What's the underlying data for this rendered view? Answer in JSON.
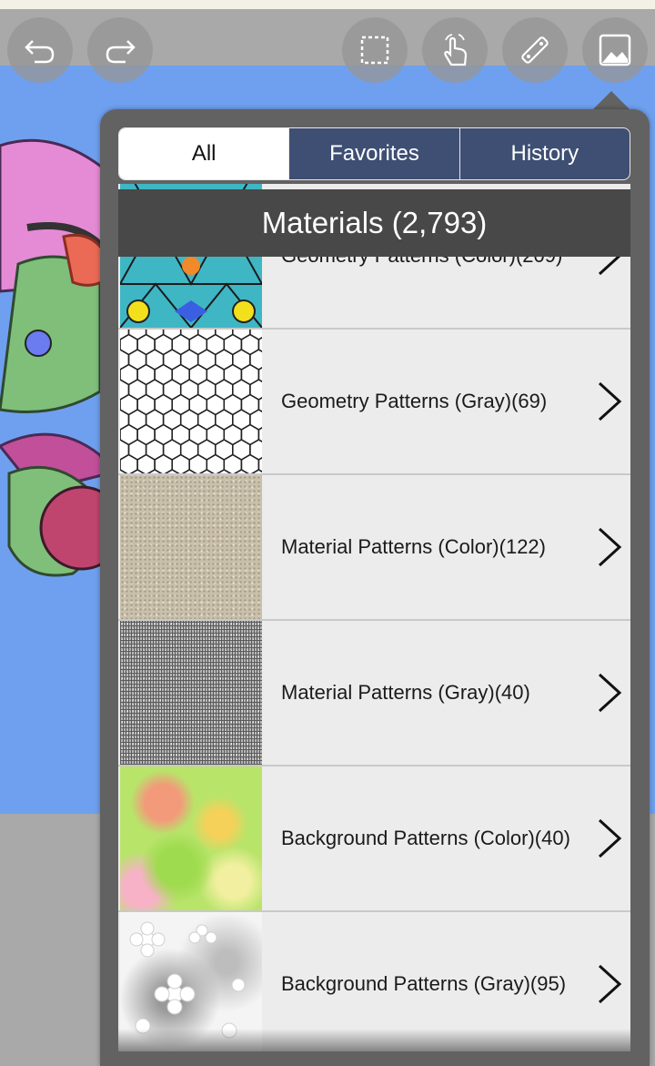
{
  "toolbar": {
    "undo_icon": "undo-icon",
    "redo_icon": "redo-icon",
    "selection_icon": "selection-icon",
    "hand_icon": "hand-icon",
    "ruler_icon": "ruler-icon",
    "material_icon": "image-icon"
  },
  "tabs": [
    {
      "label": "All",
      "active": true
    },
    {
      "label": "Favorites",
      "active": false
    },
    {
      "label": "History",
      "active": false
    }
  ],
  "materials_title": "Materials (2,793)",
  "items": [
    {
      "label": "Geometry Patterns (Color)(209)"
    },
    {
      "label": "Geometry Patterns (Gray)(69)"
    },
    {
      "label": "Material Patterns (Color)(122)"
    },
    {
      "label": "Material Patterns (Gray)(40)"
    },
    {
      "label": "Background Patterns (Color)(40)"
    },
    {
      "label": "Background Patterns (Gray)(95)"
    }
  ],
  "colors": {
    "canvas_blue": "#6fa0ef",
    "panel": "#626262",
    "tab_bar": "#3e4f73",
    "header": "#484848"
  }
}
